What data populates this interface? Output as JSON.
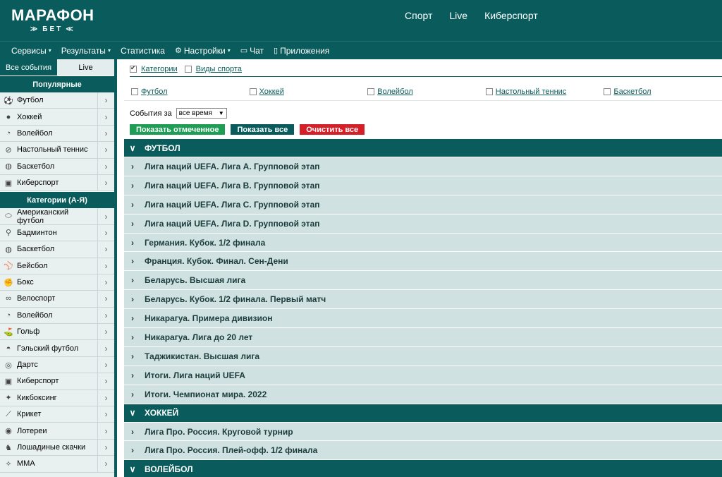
{
  "header": {
    "logo_main": "МАРАФОН",
    "logo_sub": "БЕТ",
    "nav": [
      "Спорт",
      "Live",
      "Киберспорт"
    ]
  },
  "subnav": [
    {
      "label": "Сервисы",
      "caret": true,
      "icon": ""
    },
    {
      "label": "Результаты",
      "caret": true,
      "icon": ""
    },
    {
      "label": "Статистика",
      "caret": false,
      "icon": ""
    },
    {
      "label": "Настройки",
      "caret": true,
      "icon": "gear-icon"
    },
    {
      "label": "Чат",
      "caret": false,
      "icon": "chat-icon"
    },
    {
      "label": "Приложения",
      "caret": false,
      "icon": "phone-icon"
    }
  ],
  "sidebar": {
    "tabs": [
      "Все события",
      "Live"
    ],
    "popular_title": "Популярные",
    "popular": [
      {
        "label": "Футбол",
        "icon": "football-icon"
      },
      {
        "label": "Хоккей",
        "icon": "hockey-puck-icon"
      },
      {
        "label": "Волейбол",
        "icon": "volleyball-icon"
      },
      {
        "label": "Настольный теннис",
        "icon": "table-tennis-icon"
      },
      {
        "label": "Баскетбол",
        "icon": "basketball-icon"
      },
      {
        "label": "Киберспорт",
        "icon": "gamepad-icon"
      }
    ],
    "categories_title": "Категории (А-Я)",
    "categories": [
      {
        "label": "Американский футбол",
        "icon": "american-football-icon"
      },
      {
        "label": "Бадминтон",
        "icon": "badminton-icon"
      },
      {
        "label": "Баскетбол",
        "icon": "basketball-icon"
      },
      {
        "label": "Бейсбол",
        "icon": "baseball-icon"
      },
      {
        "label": "Бокс",
        "icon": "boxing-icon"
      },
      {
        "label": "Велоспорт",
        "icon": "bicycle-icon"
      },
      {
        "label": "Волейбол",
        "icon": "volleyball-icon"
      },
      {
        "label": "Гольф",
        "icon": "golf-icon"
      },
      {
        "label": "Гэльский футбол",
        "icon": "gaelic-football-icon"
      },
      {
        "label": "Дартс",
        "icon": "darts-icon"
      },
      {
        "label": "Киберспорт",
        "icon": "gamepad-icon"
      },
      {
        "label": "Кикбоксинг",
        "icon": "kickboxing-icon"
      },
      {
        "label": "Крикет",
        "icon": "cricket-icon"
      },
      {
        "label": "Лотереи",
        "icon": "lottery-icon"
      },
      {
        "label": "Лошадиные скачки",
        "icon": "horse-racing-icon"
      },
      {
        "label": "MMA",
        "icon": "mma-icon"
      }
    ]
  },
  "filters": {
    "categories_label": "Категории",
    "categories_checked": true,
    "sports_label": "Виды спорта",
    "sports_checked": false,
    "sports": [
      "Футбол",
      "Хоккей",
      "Волейбол",
      "Настольный теннис",
      "Баскетбол"
    ],
    "period_label": "События за",
    "period_value": "все время",
    "btn_show_marked": "Показать отмеченное",
    "btn_show_all": "Показать все",
    "btn_clear": "Очистить все"
  },
  "events": [
    {
      "type": "cat",
      "title": "ФУТБОЛ"
    },
    {
      "type": "league",
      "title": "Лига наций UEFA. Лига A. Групповой этап"
    },
    {
      "type": "league",
      "title": "Лига наций UEFA. Лига B. Групповой этап"
    },
    {
      "type": "league",
      "title": "Лига наций UEFA. Лига C. Групповой этап"
    },
    {
      "type": "league",
      "title": "Лига наций UEFA. Лига D. Групповой этап"
    },
    {
      "type": "league",
      "title": "Германия. Кубок. 1/2 финала"
    },
    {
      "type": "league",
      "title": "Франция. Кубок. Финал. Сен-Дени"
    },
    {
      "type": "league",
      "title": "Беларусь. Высшая лига"
    },
    {
      "type": "league",
      "title": "Беларусь. Кубок. 1/2 финала. Первый матч"
    },
    {
      "type": "league",
      "title": "Никарагуа. Примера дивизион"
    },
    {
      "type": "league",
      "title": "Никарагуа. Лига до 20 лет"
    },
    {
      "type": "league",
      "title": "Таджикистан. Высшая лига"
    },
    {
      "type": "league",
      "title": "Итоги. Лига наций UEFA"
    },
    {
      "type": "league",
      "title": "Итоги. Чемпионат мира. 2022"
    },
    {
      "type": "cat",
      "title": "ХОККЕЙ"
    },
    {
      "type": "league",
      "title": "Лига Про. Россия. Круговой турнир"
    },
    {
      "type": "league",
      "title": "Лига Про. Россия. Плей-офф. 1/2 финала"
    },
    {
      "type": "cat",
      "title": "ВОЛЕЙБОЛ"
    }
  ],
  "colors": {
    "brand": "#0a5c5c",
    "league_bg": "#cfe1e1",
    "btn_green": "#1e9e55",
    "btn_red": "#d5202a"
  }
}
